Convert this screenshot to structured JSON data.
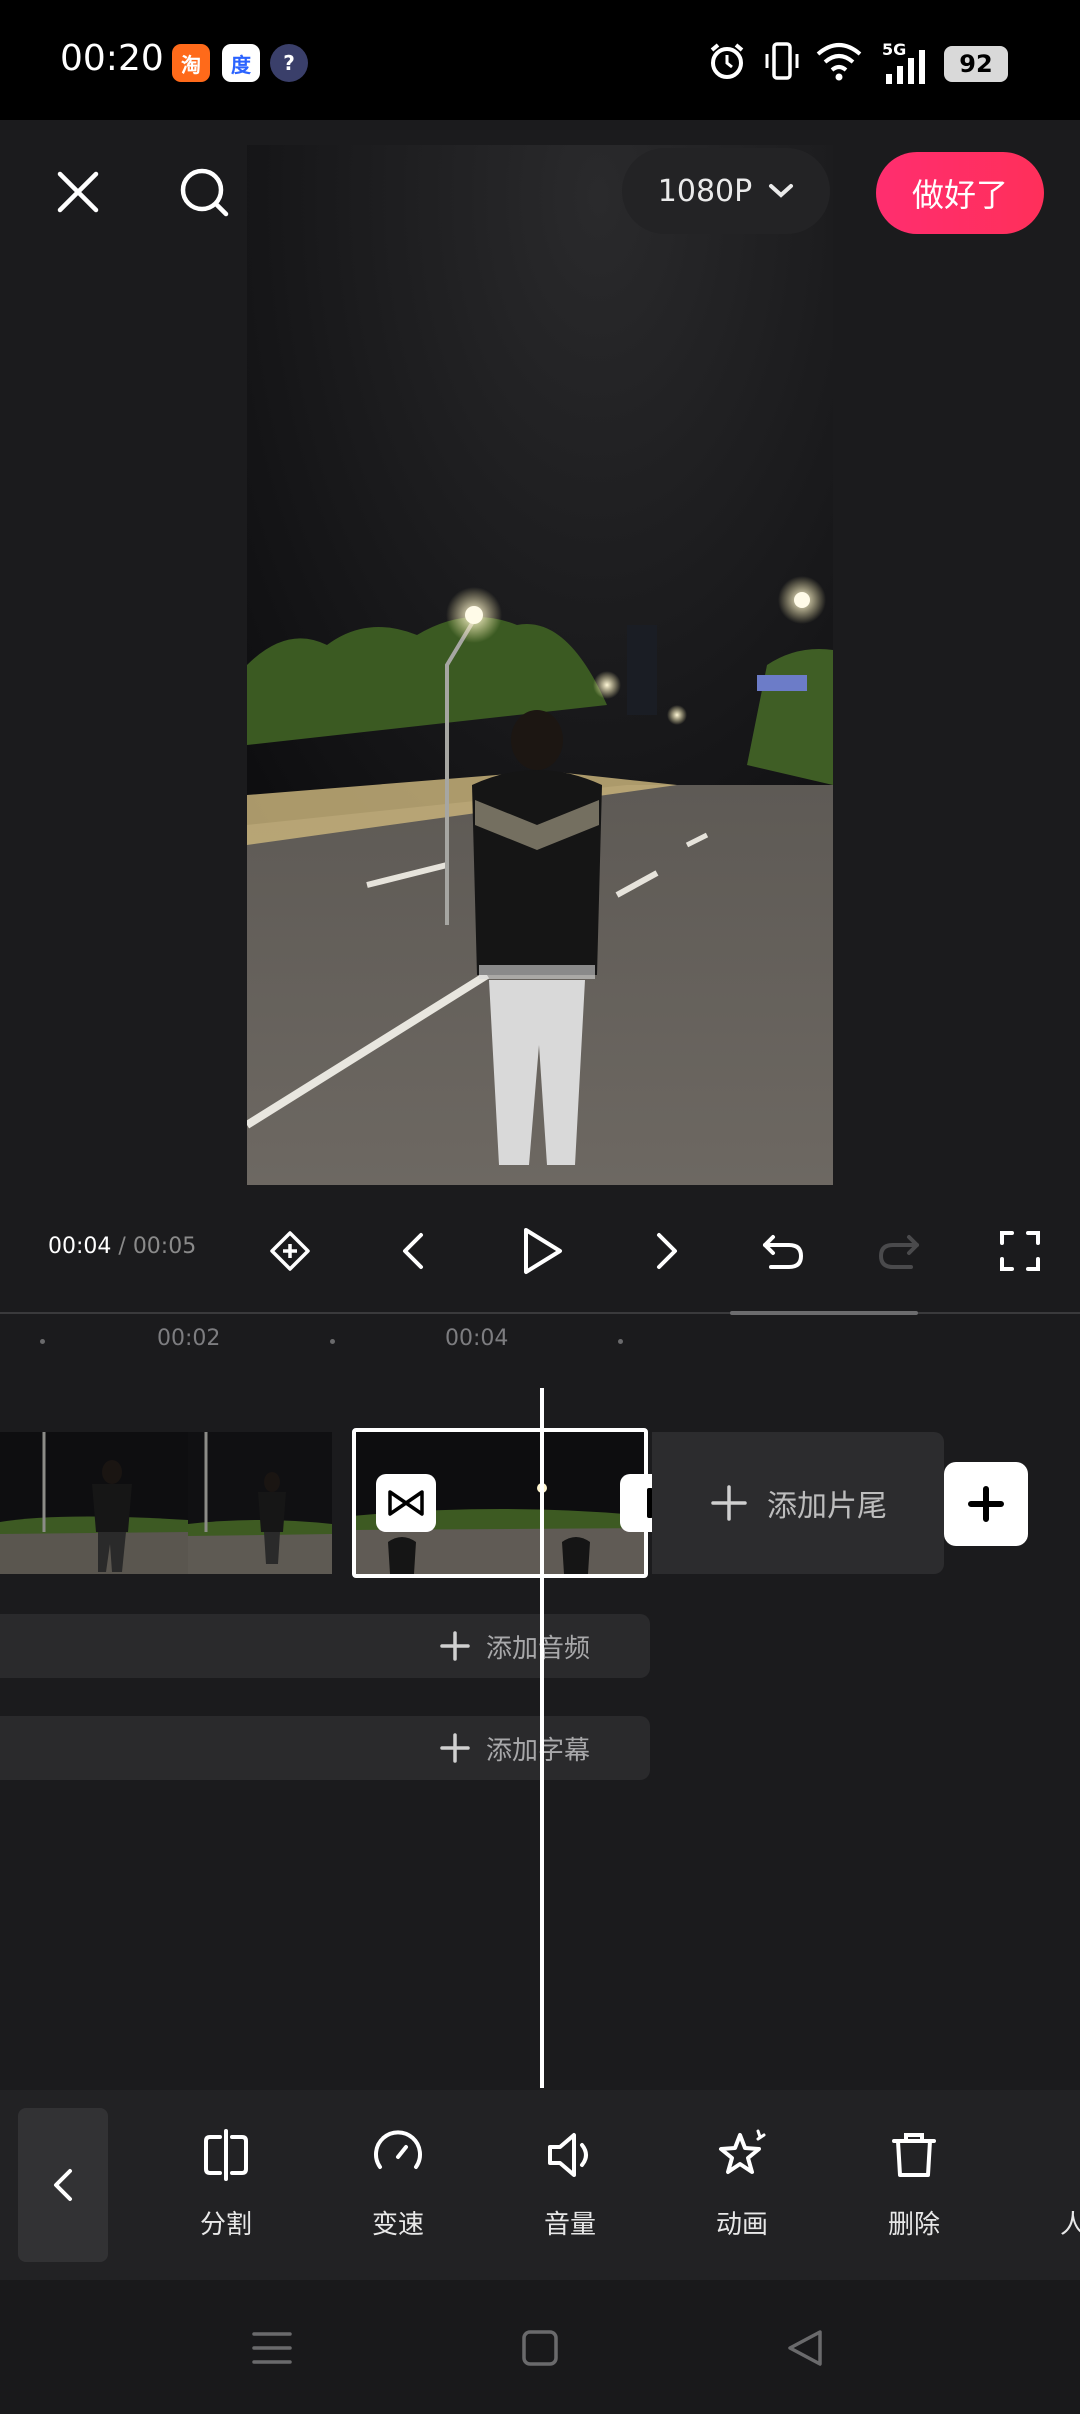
{
  "status_bar": {
    "time": "00:20",
    "battery": "92",
    "app_icons": [
      "taobao-icon",
      "baidu-icon",
      "app-icon"
    ],
    "network": "5G"
  },
  "header": {
    "resolution": "1080P",
    "done_label": "做好了"
  },
  "playback": {
    "current_time": "00:04",
    "separator": " / ",
    "total_time": "00:05"
  },
  "timeline": {
    "ruler_labels": [
      "00:02",
      "00:04"
    ],
    "add_outro_label": "添加片尾",
    "add_audio_label": "添加音频",
    "add_subtitle_label": "添加字幕"
  },
  "toolbar": {
    "items": [
      {
        "label": "分割",
        "icon": "split-icon"
      },
      {
        "label": "变速",
        "icon": "speed-icon"
      },
      {
        "label": "音量",
        "icon": "volume-icon"
      },
      {
        "label": "动画",
        "icon": "animation-icon"
      },
      {
        "label": "删除",
        "icon": "delete-icon"
      },
      {
        "label": "人声",
        "icon": "voice-icon"
      }
    ]
  },
  "colors": {
    "accent": "#ff2e6f",
    "background": "#1b1b1d",
    "toolbar": "#222224"
  }
}
